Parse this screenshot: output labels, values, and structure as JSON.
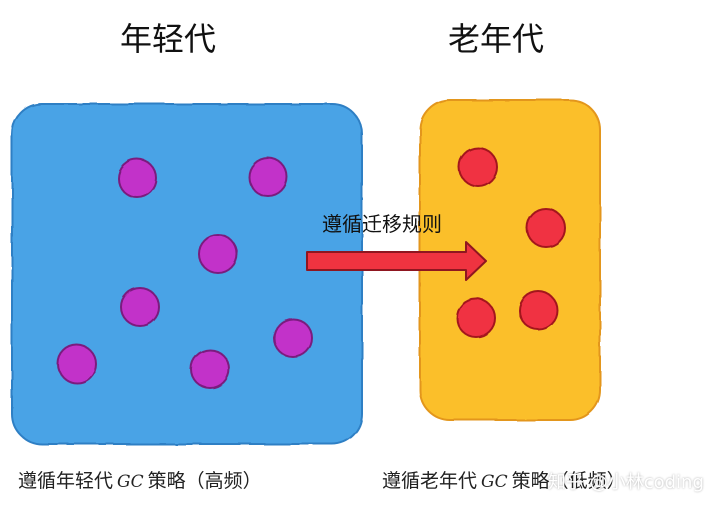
{
  "titles": {
    "young": "年轻代",
    "old": "老年代"
  },
  "arrow_label": "遵循迁移规则",
  "captions": {
    "young": {
      "prefix": "遵循年轻代",
      "gc": "GC",
      "suffix": "策略（高频）"
    },
    "old": {
      "prefix": "遵循老年代",
      "gc": "GC",
      "suffix": "策略（低频）"
    }
  },
  "watermark": "知乎 @小林coding",
  "colors": {
    "young_box": "#4aa3e6",
    "old_box": "#fbbf2c",
    "young_object": "#c231c9",
    "old_object": "#f03243",
    "arrow": "#ef3340"
  },
  "young_objects_count": 7,
  "old_objects_count": 4
}
